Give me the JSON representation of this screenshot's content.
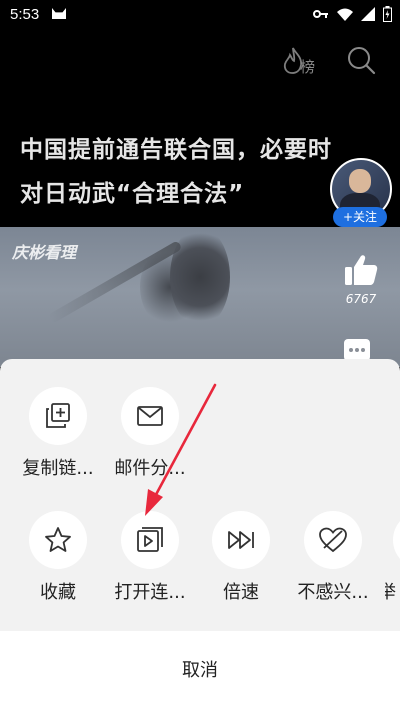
{
  "status_bar": {
    "time": "5:53"
  },
  "video": {
    "rank_label": "榜",
    "headline": "中国提前通告联合国，必要时对日动武“合理合法”",
    "follow_label": "+关注",
    "watermark_text": "庆彬看理",
    "like_count": "6767"
  },
  "share_sheet": {
    "row1": [
      {
        "label": "复制链...",
        "icon": "copy-link-icon"
      },
      {
        "label": "邮件分...",
        "icon": "email-icon"
      }
    ],
    "row2": [
      {
        "label": "收藏",
        "icon": "star-icon"
      },
      {
        "label": "打开连...",
        "icon": "open-continuous-play-icon"
      },
      {
        "label": "倍速",
        "icon": "speed-icon"
      },
      {
        "label": "不感兴...",
        "icon": "not-interested-icon"
      },
      {
        "label": "举",
        "icon": "report-icon"
      }
    ],
    "cancel_label": "取消"
  },
  "colors": {
    "accent": "#1e6fe0",
    "annotation_arrow": "#e8283c"
  }
}
